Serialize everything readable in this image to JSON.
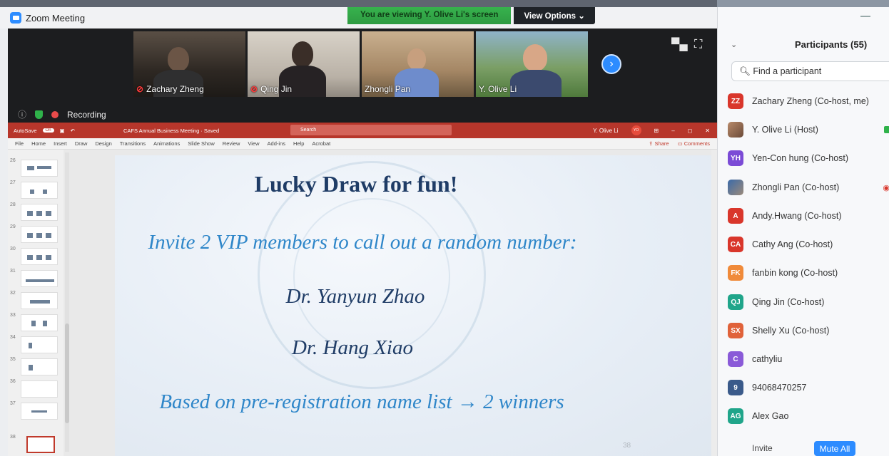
{
  "window": {
    "title": "Zoom Meeting"
  },
  "banner": {
    "viewing_text": "You are viewing Y. Olive Li's screen",
    "view_options_label": "View Options"
  },
  "videos": [
    {
      "name": "Zachary Zheng",
      "muted": true
    },
    {
      "name": "Qing Jin",
      "muted": true
    },
    {
      "name": "Zhongli Pan",
      "muted": false
    },
    {
      "name": "Y. Olive Li",
      "muted": false,
      "active": true
    }
  ],
  "recording": {
    "label": "Recording"
  },
  "powerpoint": {
    "autosave_label": "AutoSave",
    "autosave_state": "On",
    "file_title": "CAFS Annual Business Meeting · Saved",
    "search_placeholder": "Search",
    "user": "Y. Olive Li",
    "menu": [
      "File",
      "Home",
      "Insert",
      "Draw",
      "Design",
      "Transitions",
      "Animations",
      "Slide Show",
      "Review",
      "View",
      "Add-ins",
      "Help",
      "Acrobat"
    ],
    "share_label": "Share",
    "comments_label": "Comments",
    "thumb_numbers": [
      "26",
      "27",
      "28",
      "29",
      "30",
      "31",
      "32",
      "33",
      "34",
      "35",
      "36",
      "37",
      "38"
    ],
    "slide_page_number": "38"
  },
  "slide": {
    "title": "Lucky Draw for fun!",
    "line1": "Invite 2 VIP members to call out a random number:",
    "line2": "Dr. Yanyun Zhao",
    "line3": "Dr. Hang Xiao",
    "line4": "Based on pre-registration name list → 2 winners"
  },
  "participants_panel": {
    "title": "Participants (55)",
    "search_placeholder": "Find a participant",
    "participants": [
      {
        "initials": "ZZ",
        "name": "Zachary Zheng (Co-host, me)",
        "color": "#d9362b"
      },
      {
        "initials": "",
        "name": "Y. Olive Li (Host)",
        "color": "#b88a6a"
      },
      {
        "initials": "YH",
        "name": "Yen-Con hung (Co-host)",
        "color": "#7b4bd6"
      },
      {
        "initials": "",
        "name": "Zhongli Pan (Co-host)",
        "color": "#3b6aa8"
      },
      {
        "initials": "A",
        "name": "Andy.Hwang (Co-host)",
        "color": "#d9362b"
      },
      {
        "initials": "CA",
        "name": "Cathy Ang (Co-host)",
        "color": "#d9362b"
      },
      {
        "initials": "FK",
        "name": "fanbin kong (Co-host)",
        "color": "#f08a3a"
      },
      {
        "initials": "QJ",
        "name": "Qing Jin (Co-host)",
        "color": "#20a58a"
      },
      {
        "initials": "SX",
        "name": "Shelly Xu (Co-host)",
        "color": "#e0623a"
      },
      {
        "initials": "C",
        "name": "cathyliu",
        "color": "#8a5ad8"
      },
      {
        "initials": "9",
        "name": "94068470257",
        "color": "#3a5a8a"
      },
      {
        "initials": "AG",
        "name": "Alex Gao",
        "color": "#20a58a"
      }
    ],
    "invite_label": "Invite",
    "mute_all_label": "Mute All"
  }
}
